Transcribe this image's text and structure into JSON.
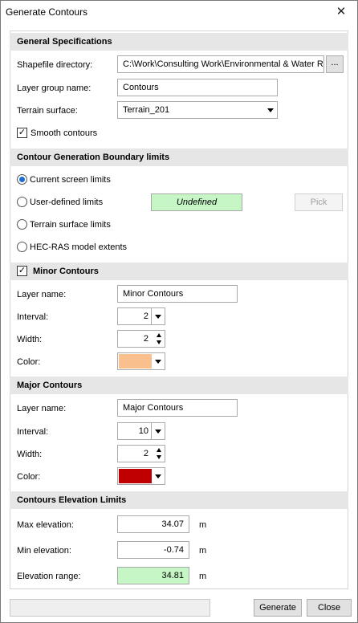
{
  "window": {
    "title": "Generate Contours",
    "close_glyph": "✕"
  },
  "general": {
    "header": "General Specifications",
    "shapefile_label": "Shapefile directory:",
    "shapefile_value": "C:\\Work\\Consulting Work\\Environmental & Water R",
    "browse_label": "...",
    "layer_group_label": "Layer group name:",
    "layer_group_value": "Contours",
    "terrain_label": "Terrain surface:",
    "terrain_value": "Terrain_201",
    "smooth_label": "Smooth contours",
    "smooth_checked": true
  },
  "boundary": {
    "header": "Contour Generation Boundary limits",
    "options": [
      {
        "label": "Current screen limits",
        "checked": true
      },
      {
        "label": "User-defined limits",
        "checked": false
      },
      {
        "label": "Terrain surface limits",
        "checked": false
      },
      {
        "label": "HEC-RAS model extents",
        "checked": false
      }
    ],
    "undefined_label": "Undefined",
    "pick_label": "Pick"
  },
  "minor": {
    "header": "Minor Contours",
    "enabled": true,
    "layer_label": "Layer name:",
    "layer_value": "Minor Contours",
    "interval_label": "Interval:",
    "interval_value": "2",
    "width_label": "Width:",
    "width_value": "2",
    "color_label": "Color:",
    "color": "#f9c08e"
  },
  "major": {
    "header": "Major Contours",
    "layer_label": "Layer name:",
    "layer_value": "Major Contours",
    "interval_label": "Interval:",
    "interval_value": "10",
    "width_label": "Width:",
    "width_value": "2",
    "color_label": "Color:",
    "color": "#c00000"
  },
  "elevation": {
    "header": "Contours Elevation Limits",
    "max_label": "Max elevation:",
    "max_value": "34.07",
    "min_label": "Min elevation:",
    "min_value": "-0.74",
    "range_label": "Elevation range:",
    "range_value": "34.81",
    "unit": "m"
  },
  "footer": {
    "generate_label": "Generate",
    "close_label": "Close"
  }
}
